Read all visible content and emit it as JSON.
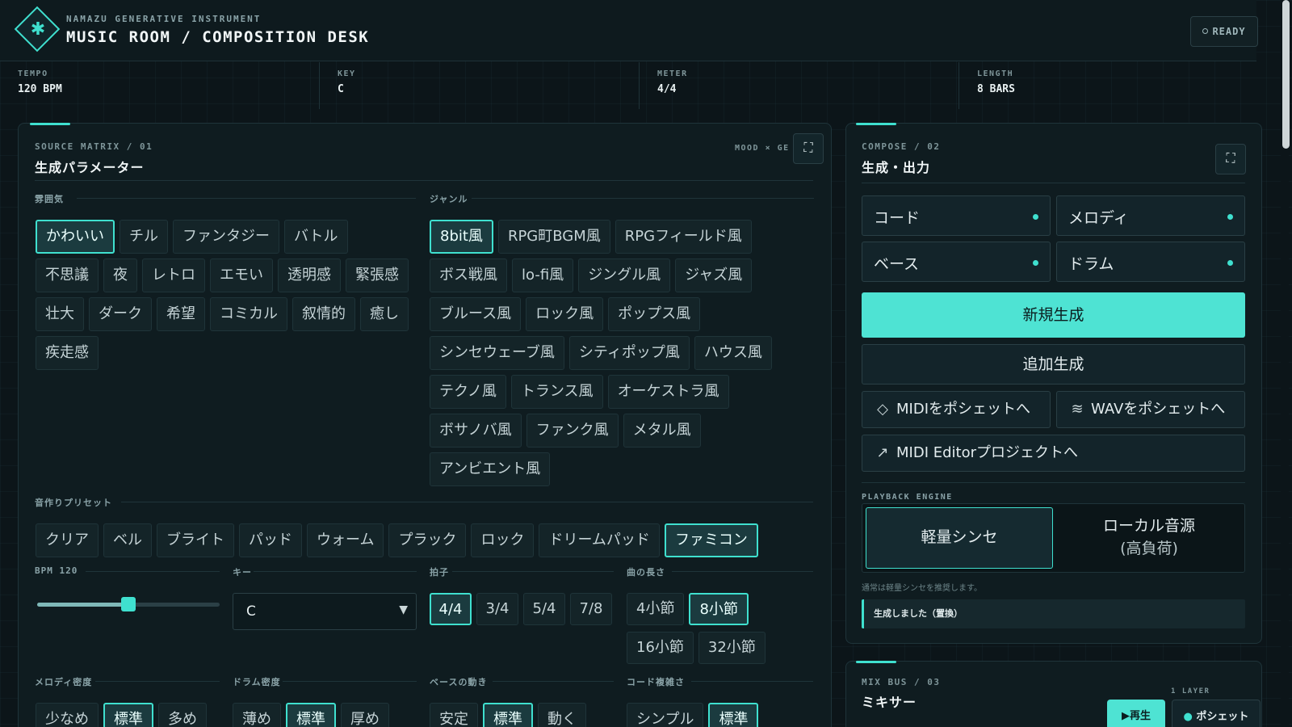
{
  "header": {
    "subtitle": "NAMAZU GENERATIVE INSTRUMENT",
    "title": "MUSIC ROOM / COMPOSITION DESK",
    "status": "READY"
  },
  "stats": [
    {
      "label": "TEMPO",
      "value": "120 BPM"
    },
    {
      "label": "KEY",
      "value": "C"
    },
    {
      "label": "METER",
      "value": "4/4"
    },
    {
      "label": "LENGTH",
      "value": "8 BARS"
    }
  ],
  "source": {
    "sub": "SOURCE MATRIX / 01",
    "title": "生成パラメーター",
    "right_label": "MOOD × GE",
    "mood_label": "雰囲気",
    "genre_label": "ジャンル",
    "moods": [
      "かわいい",
      "チル",
      "ファンタジー",
      "バトル",
      "不思議",
      "夜",
      "レトロ",
      "エモい",
      "透明感",
      "緊張感",
      "壮大",
      "ダーク",
      "希望",
      "コミカル",
      "叙情的",
      "癒し",
      "疾走感"
    ],
    "genres": [
      "8bit風",
      "RPG町BGM風",
      "RPGフィールド風",
      "ボス戦風",
      "lo-fi風",
      "ジングル風",
      "ジャズ風",
      "ブルース風",
      "ロック風",
      "ポップス風",
      "シンセウェーブ風",
      "シティポップ風",
      "ハウス風",
      "テクノ風",
      "トランス風",
      "オーケストラ風",
      "ボサノバ風",
      "ファンク風",
      "メタル風",
      "アンビエント風"
    ],
    "preset_label": "音作りプリセット",
    "presets": [
      "クリア",
      "ベル",
      "ブライト",
      "パッド",
      "ウォーム",
      "プラック",
      "ロック",
      "ドリームパッド",
      "ファミコン"
    ],
    "bpm_label": "BPM 120",
    "bpm_value": 120,
    "key_label": "キー",
    "key_value": "C",
    "meter_label": "拍子",
    "meters": [
      "4/4",
      "3/4",
      "5/4",
      "7/8"
    ],
    "length_label": "曲の長さ",
    "lengths": [
      "4小節",
      "8小節",
      "16小節",
      "32小節"
    ],
    "melody_density_label": "メロディ密度",
    "melody_density": [
      "少なめ",
      "標準",
      "多め"
    ],
    "drum_density_label": "ドラム密度",
    "drum_density": [
      "薄め",
      "標準",
      "厚め"
    ],
    "bass_motion_label": "ベースの動き",
    "bass_motion": [
      "安定",
      "標準",
      "動く"
    ],
    "chord_complexity_label": "コード複雑さ",
    "chord_complexity": [
      "シンプル",
      "標準"
    ]
  },
  "compose": {
    "sub": "COMPOSE / 02",
    "title": "生成・出力",
    "parts": [
      "コード",
      "メロディ",
      "ベース",
      "ドラム"
    ],
    "new_label": "新規生成",
    "add_label": "追加生成",
    "midi_pochette": "MIDIをポシェットへ",
    "wav_pochette": "WAVをポシェットへ",
    "midi_editor": "MIDI Editorプロジェクトへ",
    "engine_label": "PLAYBACK ENGINE",
    "engine_light": "軽量シンセ",
    "engine_local_1": "ローカル音源",
    "engine_local_2": "(高負荷)",
    "hint": "通常は軽量シンセを推奨します。",
    "status": "生成しました（置換）"
  },
  "mix": {
    "sub": "MIX BUS / 03",
    "title": "ミキサー",
    "layer": "1 LAYER",
    "play": "▶再生",
    "pochette": "ポシェット"
  },
  "icons": {
    "logo": "star-icon",
    "expand": "expand-icon",
    "midi": "diamond-icon",
    "wav": "wave-icon",
    "editor": "arrow-up-right-icon"
  },
  "colors": {
    "accent": "#3fe0cf",
    "background": "#0c1519",
    "panel": "#0f1c20"
  }
}
